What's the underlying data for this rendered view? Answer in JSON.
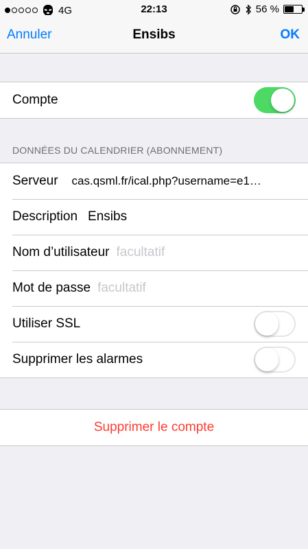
{
  "status_bar": {
    "signal_dots": [
      true,
      false,
      false,
      false,
      false
    ],
    "carrier_icon": "stormtrooper-icon",
    "network": "4G",
    "time": "22:13",
    "rotation_lock_icon": "rotation-lock-icon",
    "bluetooth_icon": "bluetooth-icon",
    "battery_percent_label": "56 %",
    "battery_level": 0.56
  },
  "nav": {
    "cancel_label": "Annuler",
    "title": "Ensibs",
    "done_label": "OK"
  },
  "account": {
    "label": "Compte",
    "enabled": true
  },
  "calendar_section": {
    "header": "DONNÉES DU CALENDRIER (ABONNEMENT)",
    "server_label": "Serveur",
    "server_value": "cas.qsml.fr/ical.php?username=e1…",
    "description_label": "Description",
    "description_value": "Ensibs",
    "username_label": "Nom d’utilisateur",
    "username_placeholder": "facultatif",
    "password_label": "Mot de passe",
    "password_placeholder": "facultatif",
    "ssl_label": "Utiliser SSL",
    "ssl_enabled": false,
    "alarms_label": "Supprimer les alarmes",
    "alarms_enabled": false
  },
  "delete": {
    "label": "Supprimer le compte"
  },
  "colors": {
    "accent": "#007aff",
    "toggle_on": "#4cd964",
    "destructive": "#ff3b30",
    "background": "#efeff4"
  }
}
